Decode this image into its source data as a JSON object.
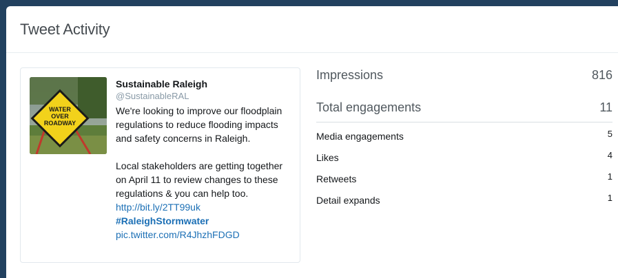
{
  "modal": {
    "title": "Tweet Activity"
  },
  "tweet": {
    "author_name": "Sustainable Raleigh",
    "author_handle": "@SustainableRAL",
    "media_alt": "WATER OVER ROADWAY",
    "sign_lines": [
      "WATER",
      "OVER",
      "ROADWAY"
    ],
    "paragraph1": "We're looking to improve our floodplain regulations to reduce flooding impacts and safety concerns in Raleigh.",
    "paragraph2_text": "Local stakeholders are getting together on April 11 to review changes to these regulations & you can help too.",
    "link": "http://bit.ly/2TT99uk",
    "hashtag": "#RaleighStormwater",
    "pic_link": "pic.twitter.com/R4JhzhFDGD"
  },
  "stats": {
    "impressions": {
      "label": "Impressions",
      "value": "816"
    },
    "total_engagements": {
      "label": "Total engagements",
      "value": "11"
    },
    "breakdown": [
      {
        "label": "Media engagements",
        "value": "5"
      },
      {
        "label": "Likes",
        "value": "4"
      },
      {
        "label": "Retweets",
        "value": "1"
      },
      {
        "label": "Detail expands",
        "value": "1"
      }
    ]
  },
  "colors": {
    "background": "#22415f",
    "link": "#1b6fb5",
    "sign_yellow": "#f2d21b"
  }
}
